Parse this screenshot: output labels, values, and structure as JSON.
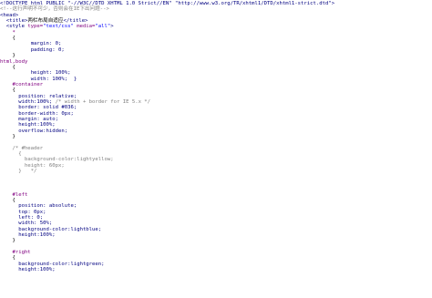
{
  "editor": {
    "lines": [
      {
        "indent": 0,
        "parts": [
          {
            "t": "<!DOCTYPE html PUBLIC \"-//W3C//DTD XHTML 1.0 Strict//EN\" \"http://www.w3.org/TR/xhtml1/DTD/xhtml1-strict.dtd\">",
            "c": "c-tag"
          }
        ]
      },
      {
        "indent": 0,
        "parts": [
          {
            "t": "<!--这行声明不可少，否则会在IE下出问题-->",
            "c": "c-com"
          }
        ]
      },
      {
        "indent": 0,
        "parts": [
          {
            "t": "<head>",
            "c": "c-tag"
          }
        ]
      },
      {
        "indent": 2,
        "parts": [
          {
            "t": "<title>",
            "c": "c-tag"
          },
          {
            "t": "两栏布局自适应",
            "c": "c-txt"
          },
          {
            "t": "</title>",
            "c": "c-tag"
          }
        ]
      },
      {
        "indent": 2,
        "parts": [
          {
            "t": "<style ",
            "c": "c-tag"
          },
          {
            "t": "type=",
            "c": "c-attr"
          },
          {
            "t": "\"text/css\" ",
            "c": "c-str"
          },
          {
            "t": "media=",
            "c": "c-attr"
          },
          {
            "t": "\"all\"",
            "c": "c-str"
          },
          {
            "t": ">",
            "c": "c-tag"
          }
        ]
      },
      {
        "indent": 4,
        "parts": [
          {
            "t": "*",
            "c": "c-sel"
          }
        ]
      },
      {
        "indent": 4,
        "parts": [
          {
            "t": "{",
            "c": "c-punc"
          }
        ]
      },
      {
        "indent": 10,
        "parts": [
          {
            "t": "margin: 0;",
            "c": "c-prop"
          }
        ]
      },
      {
        "indent": 10,
        "parts": [
          {
            "t": "padding: 0;",
            "c": "c-prop"
          }
        ]
      },
      {
        "indent": 4,
        "parts": [
          {
            "t": "}",
            "c": "c-punc"
          }
        ]
      },
      {
        "indent": 0,
        "parts": [
          {
            "t": "html,body",
            "c": "c-sel"
          }
        ]
      },
      {
        "indent": 4,
        "parts": [
          {
            "t": "{",
            "c": "c-punc"
          }
        ]
      },
      {
        "indent": 10,
        "parts": [
          {
            "t": "height: 100%;",
            "c": "c-prop"
          }
        ]
      },
      {
        "indent": 10,
        "parts": [
          {
            "t": "width: 100%;  }",
            "c": "c-prop"
          }
        ]
      },
      {
        "indent": 4,
        "parts": [
          {
            "t": "#container",
            "c": "c-sel"
          }
        ]
      },
      {
        "indent": 4,
        "parts": [
          {
            "t": "{",
            "c": "c-punc"
          }
        ]
      },
      {
        "indent": 6,
        "parts": [
          {
            "t": "position: relative;",
            "c": "c-prop"
          }
        ]
      },
      {
        "indent": 6,
        "parts": [
          {
            "t": "width:100%; ",
            "c": "c-prop"
          },
          {
            "t": "/* width + border for IE 5.x */",
            "c": "c-com"
          }
        ]
      },
      {
        "indent": 6,
        "parts": [
          {
            "t": "border: solid #036;",
            "c": "c-prop"
          }
        ]
      },
      {
        "indent": 6,
        "parts": [
          {
            "t": "border-width: 0px;",
            "c": "c-prop"
          }
        ]
      },
      {
        "indent": 6,
        "parts": [
          {
            "t": "margin: auto;",
            "c": "c-prop"
          }
        ]
      },
      {
        "indent": 6,
        "parts": [
          {
            "t": "height:100%;",
            "c": "c-prop"
          }
        ]
      },
      {
        "indent": 6,
        "parts": [
          {
            "t": "overflow:hidden;",
            "c": "c-prop"
          }
        ]
      },
      {
        "indent": 4,
        "parts": [
          {
            "t": "}",
            "c": "c-punc"
          }
        ]
      },
      {
        "indent": 0,
        "parts": [
          {
            "t": "",
            "c": "c-txt"
          }
        ]
      },
      {
        "indent": 4,
        "parts": [
          {
            "t": "/* #header",
            "c": "c-com"
          }
        ]
      },
      {
        "indent": 6,
        "parts": [
          {
            "t": "{",
            "c": "c-com"
          }
        ]
      },
      {
        "indent": 8,
        "parts": [
          {
            "t": "background-color:lightyellow;",
            "c": "c-com"
          }
        ]
      },
      {
        "indent": 8,
        "parts": [
          {
            "t": "height: 60px;",
            "c": "c-com"
          }
        ]
      },
      {
        "indent": 6,
        "parts": [
          {
            "t": "}   */",
            "c": "c-com"
          }
        ]
      },
      {
        "indent": 0,
        "parts": [
          {
            "t": "",
            "c": "c-txt"
          }
        ]
      },
      {
        "indent": 0,
        "parts": [
          {
            "t": "",
            "c": "c-txt"
          }
        ]
      },
      {
        "indent": 0,
        "parts": [
          {
            "t": "",
            "c": "c-txt"
          }
        ]
      },
      {
        "indent": 4,
        "parts": [
          {
            "t": "#left",
            "c": "c-sel"
          }
        ]
      },
      {
        "indent": 4,
        "parts": [
          {
            "t": "{",
            "c": "c-punc"
          }
        ]
      },
      {
        "indent": 6,
        "parts": [
          {
            "t": "position: absolute;",
            "c": "c-prop"
          }
        ]
      },
      {
        "indent": 6,
        "parts": [
          {
            "t": "top: 0px;",
            "c": "c-prop"
          }
        ]
      },
      {
        "indent": 6,
        "parts": [
          {
            "t": "left: 0;",
            "c": "c-prop"
          }
        ]
      },
      {
        "indent": 6,
        "parts": [
          {
            "t": "width: 50%;",
            "c": "c-prop"
          }
        ]
      },
      {
        "indent": 6,
        "parts": [
          {
            "t": "background-color:lightblue;",
            "c": "c-prop"
          }
        ]
      },
      {
        "indent": 6,
        "parts": [
          {
            "t": "height:100%;",
            "c": "c-prop"
          }
        ]
      },
      {
        "indent": 4,
        "parts": [
          {
            "t": "}",
            "c": "c-punc"
          }
        ]
      },
      {
        "indent": 0,
        "parts": [
          {
            "t": "",
            "c": "c-txt"
          }
        ]
      },
      {
        "indent": 4,
        "parts": [
          {
            "t": "#right",
            "c": "c-sel"
          }
        ]
      },
      {
        "indent": 4,
        "parts": [
          {
            "t": "{",
            "c": "c-punc"
          }
        ]
      },
      {
        "indent": 6,
        "parts": [
          {
            "t": "background-color:lightgreen;",
            "c": "c-prop"
          }
        ]
      },
      {
        "indent": 6,
        "parts": [
          {
            "t": "height:100%;",
            "c": "c-prop"
          }
        ]
      }
    ]
  }
}
